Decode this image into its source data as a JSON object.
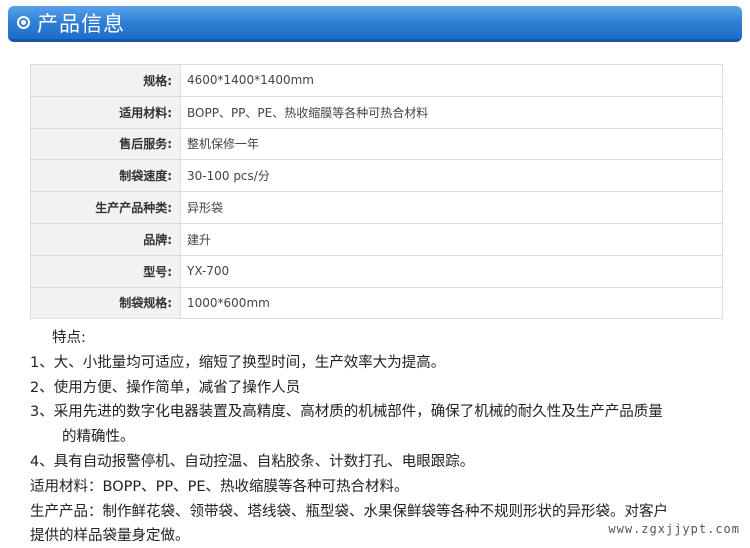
{
  "header": {
    "title": "产品信息"
  },
  "specs": [
    {
      "key": "规格:",
      "value": "4600*1400*1400mm"
    },
    {
      "key": "适用材料:",
      "value": "BOPP、PP、PE、热收缩膜等各种可热合材料"
    },
    {
      "key": "售后服务:",
      "value": "整机保修一年"
    },
    {
      "key": "制袋速度:",
      "value": "30-100 pcs/分"
    },
    {
      "key": "生产产品种类:",
      "value": "异形袋"
    },
    {
      "key": "品牌:",
      "value": "建升"
    },
    {
      "key": "型号:",
      "value": "YX-700"
    },
    {
      "key": "制袋规格:",
      "value": "1000*600mm"
    }
  ],
  "features": {
    "heading": "特点:",
    "item1": "1、大、小批量均可适应，缩短了换型时间，生产效率大为提高。",
    "item2": "2、使用方便、操作简单，减省了操作人员",
    "item3a": "3、采用先进的数字化电器装置及高精度、高材质的机械部件，确保了机械的耐久性及生产产品质量",
    "item3b": "的精确性。",
    "item4": "4、具有自动报警停机、自动控温、自粘胶条、计数打孔、电眼跟踪。",
    "materials": "适用材料：BOPP、PP、PE、热收缩膜等各种可热合材料。",
    "products_a": "生产产品：制作鲜花袋、领带袋、塔线袋、瓶型袋、水果保鲜袋等各种不规则形状的异形袋。对客户",
    "products_b": "提供的样品袋量身定做。"
  },
  "watermark": "www.zgxjjypt.com"
}
